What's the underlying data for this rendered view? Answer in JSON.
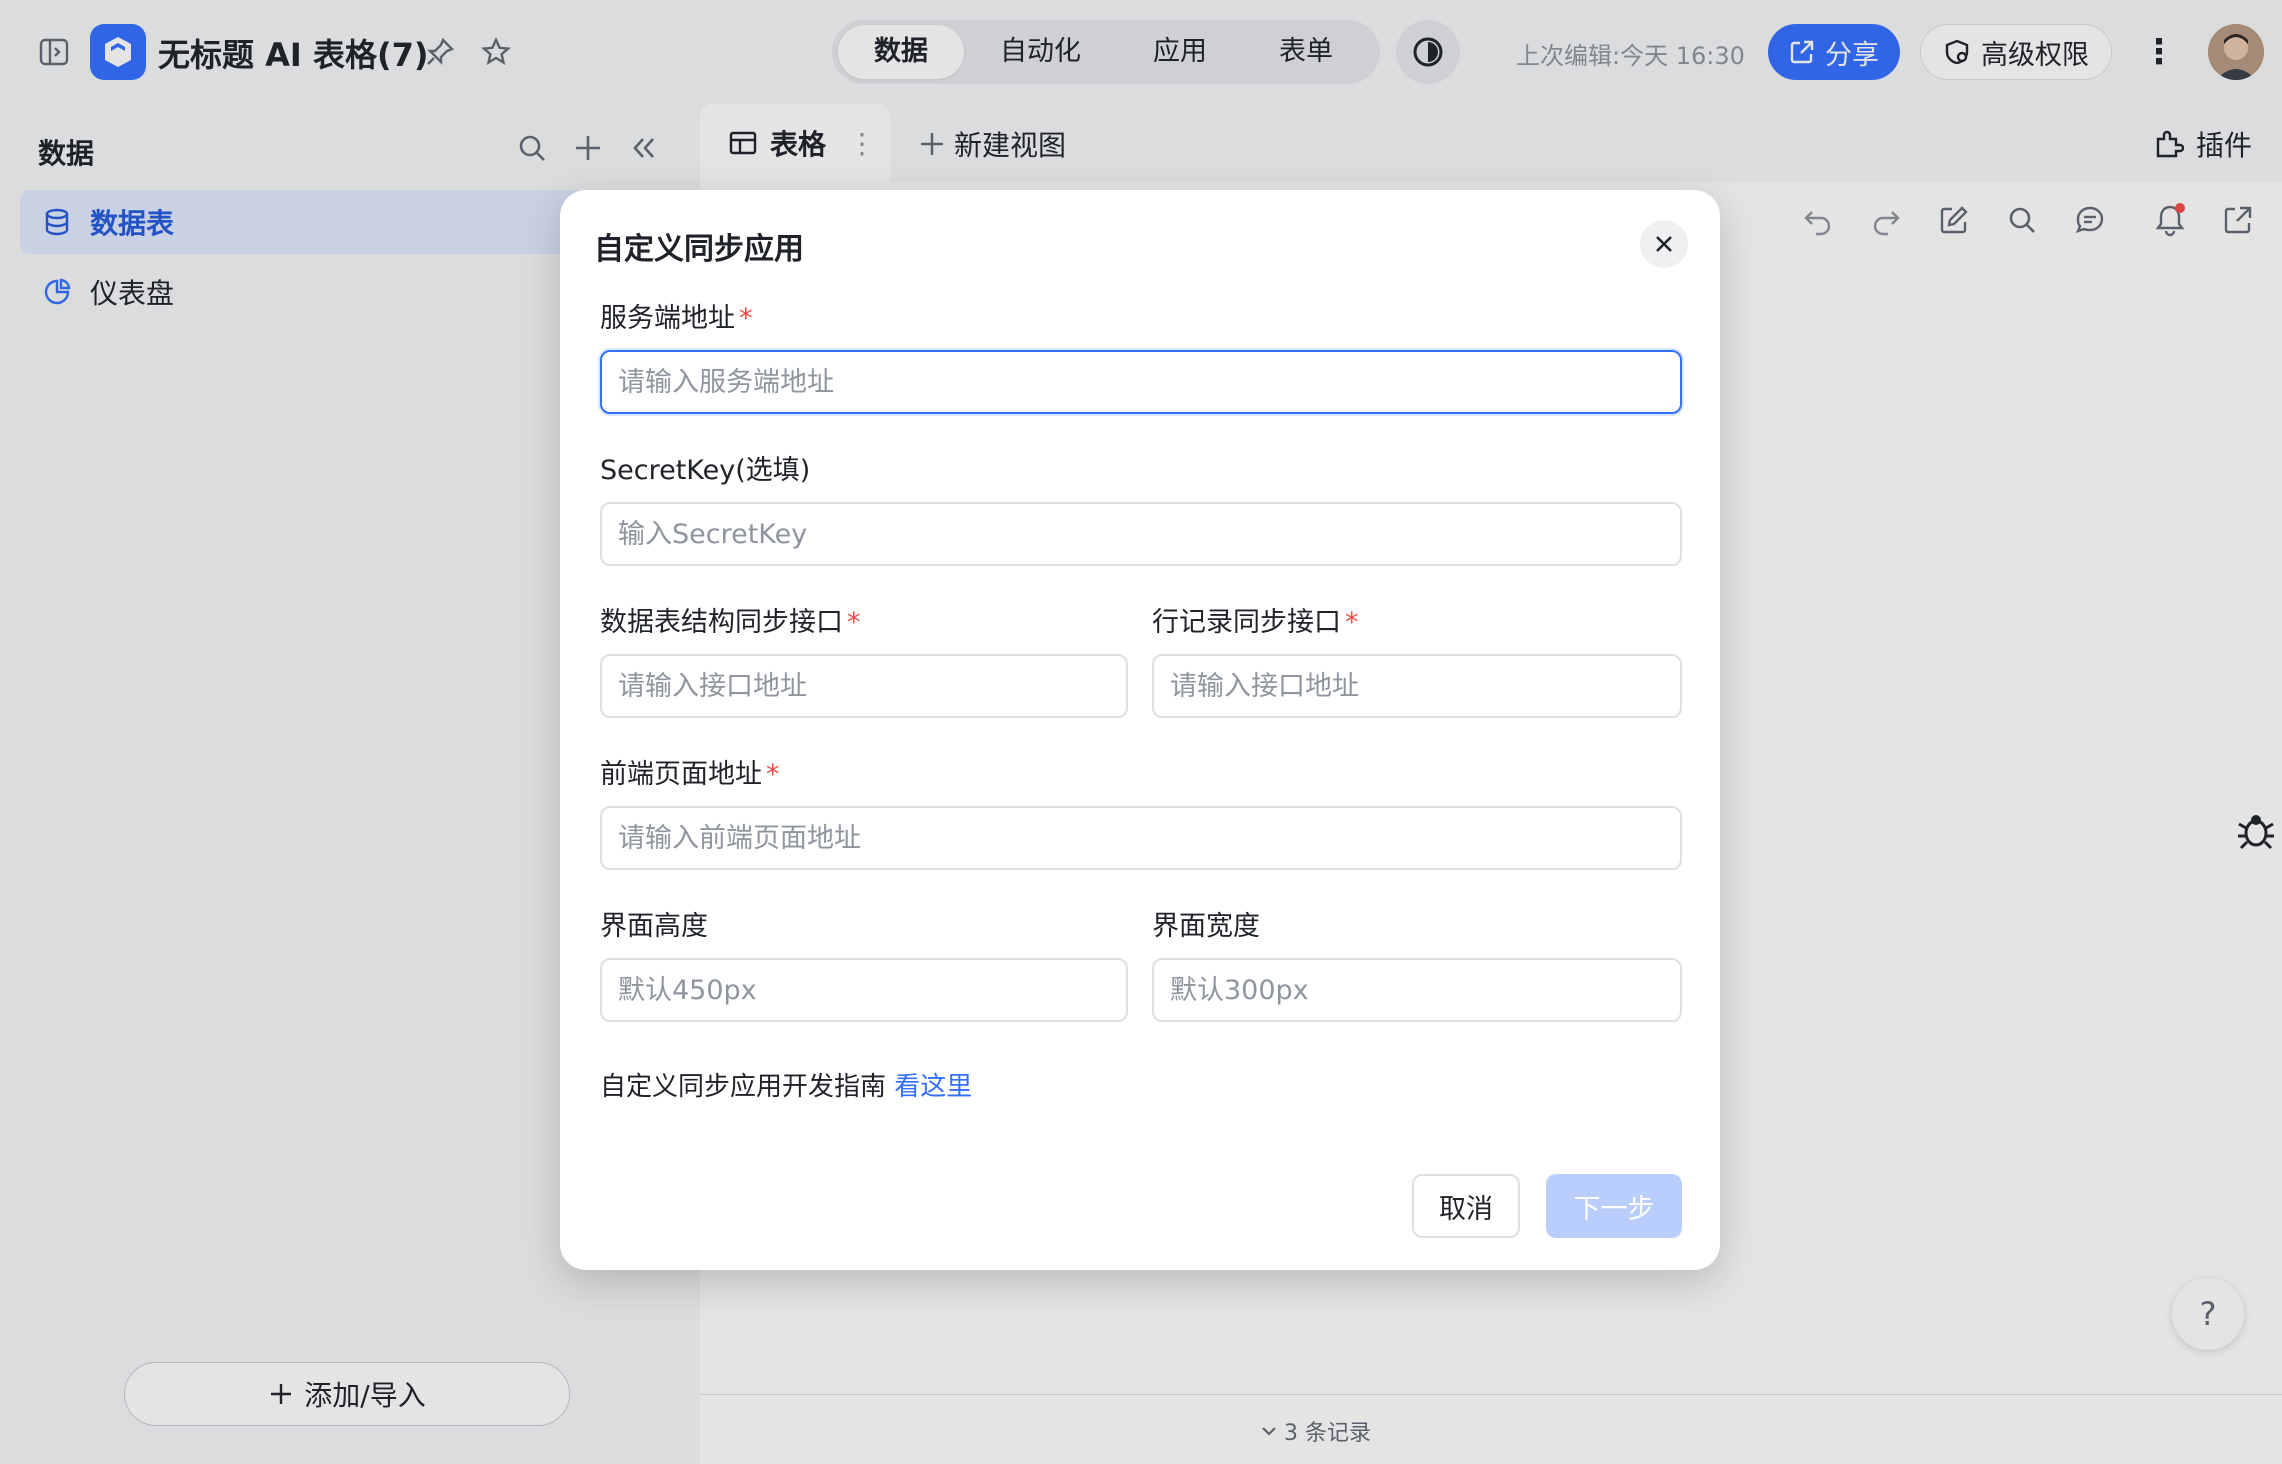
{
  "header": {
    "doc_title": "无标题 AI 表格(7)",
    "tabs": [
      {
        "label": "数据",
        "active": true
      },
      {
        "label": "自动化",
        "active": false
      },
      {
        "label": "应用",
        "active": false
      },
      {
        "label": "表单",
        "active": false
      }
    ],
    "last_edit": "上次编辑:今天 16:30",
    "share_label": "分享",
    "permission_label": "高级权限",
    "icons": [
      "sidebar-toggle-icon",
      "pin-icon",
      "star-icon",
      "theme-icon",
      "more-icon",
      "avatar"
    ]
  },
  "sidebar": {
    "title": "数据",
    "items": [
      {
        "label": "数据表",
        "icon": "database-icon",
        "active": true
      },
      {
        "label": "仪表盘",
        "icon": "dashboard-icon",
        "active": false
      }
    ],
    "add_label": "添加/导入"
  },
  "main": {
    "view_tab_label": "表格",
    "new_view_label": "新建视图",
    "plugin_label": "插件",
    "record_count": "3 条记录"
  },
  "dialog": {
    "title": "自定义同步应用",
    "fields": {
      "server_url": {
        "label": "服务端地址",
        "placeholder": "请输入服务端地址",
        "required": true
      },
      "secret_key": {
        "label": "SecretKey(选填)",
        "placeholder": "输入SecretKey",
        "required": false
      },
      "schema_api": {
        "label": "数据表结构同步接口",
        "placeholder": "请输入接口地址",
        "required": true
      },
      "record_api": {
        "label": "行记录同步接口",
        "placeholder": "请输入接口地址",
        "required": true
      },
      "frontend_url": {
        "label": "前端页面地址",
        "placeholder": "请输入前端页面地址",
        "required": true
      },
      "height": {
        "label": "界面高度",
        "placeholder": "默认450px",
        "required": false
      },
      "width": {
        "label": "界面宽度",
        "placeholder": "默认300px",
        "required": false
      }
    },
    "required_mark": "*",
    "guide_text": "自定义同步应用开发指南",
    "guide_link": "看这里",
    "cancel_label": "取消",
    "next_label": "下一步"
  },
  "colors": {
    "accent": "#3370ff",
    "required": "#f54a45",
    "disabled_button": "#bacefd"
  }
}
